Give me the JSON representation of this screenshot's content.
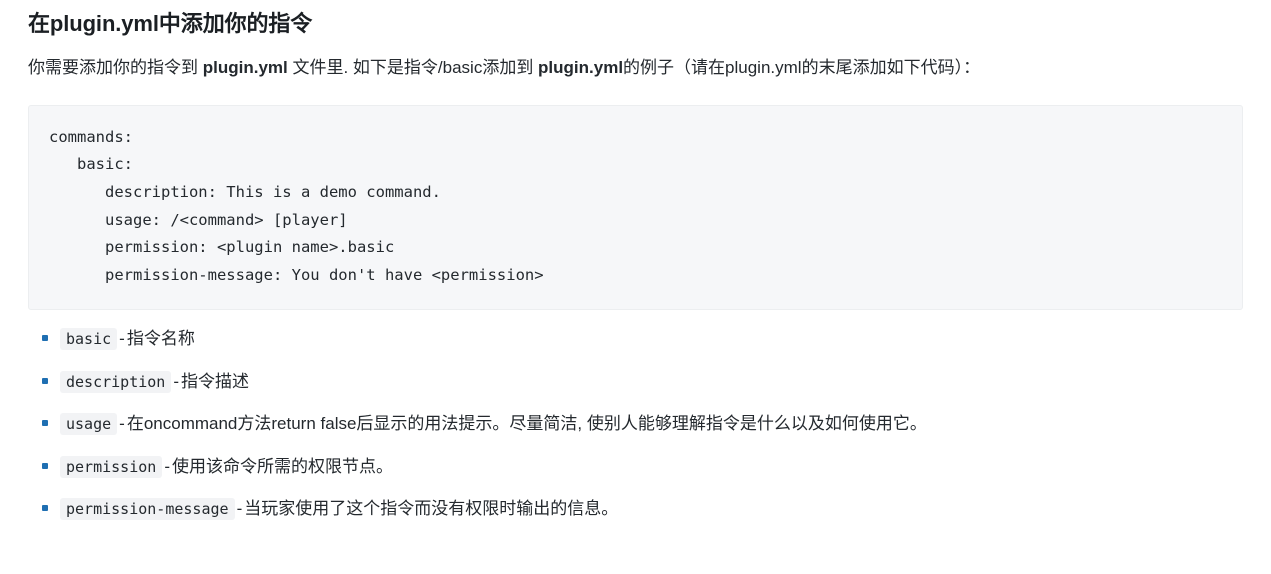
{
  "heading": "在plugin.yml中添加你的指令",
  "paragraph": {
    "part1": "你需要添加你的指令到 ",
    "code1": "plugin.yml",
    "part2": " 文件里. 如下是指令/basic添加到 ",
    "code2": "plugin.yml",
    "part3": "的例子（请在plugin.yml的末尾添加如下代码）："
  },
  "code_block": {
    "language": "yaml",
    "content": "commands:\n   basic:\n      description: This is a demo command.\n      usage: /<command> [player]\n      permission: <plugin name>.basic\n      permission-message: You don't have <permission>"
  },
  "list": [
    {
      "code": "basic",
      "dash": "-",
      "text": "指令名称"
    },
    {
      "code": "description",
      "dash": "-",
      "text": "指令描述"
    },
    {
      "code": "usage",
      "dash": "-",
      "text": "在oncommand方法return false后显示的用法提示。尽量简洁, 使别人能够理解指令是什么以及如何使用它。"
    },
    {
      "code": "permission",
      "dash": "-",
      "text": "使用该命令所需的权限节点。"
    },
    {
      "code": "permission-message",
      "dash": "-",
      "text": "当玩家使用了这个指令而没有权限时输出的信息。"
    }
  ],
  "colors": {
    "text": "#24292e",
    "heading": "#1b1f23",
    "code_bg": "#f6f7f9",
    "code_border": "#eceef0",
    "inline_code_bg": "#f2f3f5",
    "bullet": "#1f6fb2"
  }
}
